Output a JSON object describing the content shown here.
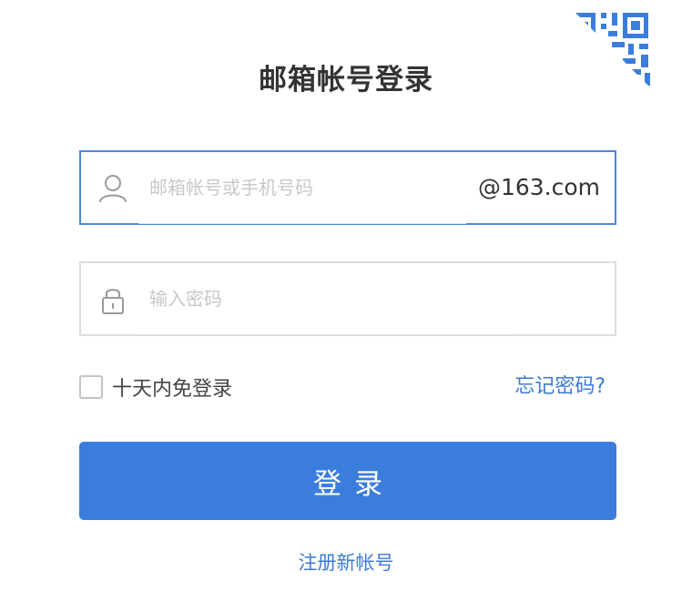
{
  "title": "邮箱帐号登录",
  "account": {
    "placeholder": "邮箱帐号或手机号码",
    "value": "",
    "suffix": "@163.com",
    "icon": "user-icon"
  },
  "password": {
    "placeholder": "输入密码",
    "value": "",
    "icon": "lock-icon"
  },
  "remember": {
    "label": "十天内免登录",
    "checked": false
  },
  "forgot_label": "忘记密码?",
  "login_label": "登录",
  "register_label": "注册新帐号",
  "qr_icon": "qr-code-icon",
  "colors": {
    "accent": "#3b7ddd",
    "link": "#3d7ad6",
    "focus_border": "#4a86e0",
    "border": "#dcdcdc",
    "title": "#333333",
    "qr": "#3b7ddd"
  }
}
